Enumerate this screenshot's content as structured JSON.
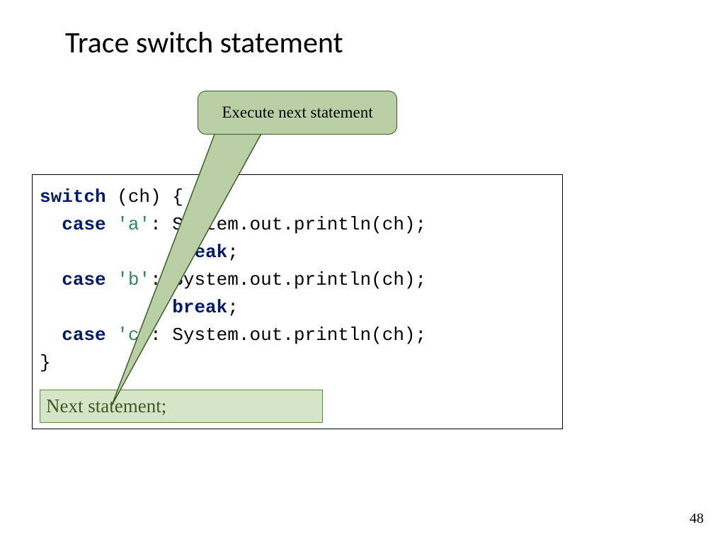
{
  "title": "Trace switch statement",
  "callout_label": "Execute next statement",
  "code": {
    "line1_kw": "switch",
    "line1_rest": " (ch) {",
    "case_kw": "case",
    "break_kw": "break",
    "lit_a": "'a'",
    "lit_b": "'b'",
    "lit_c": "'c'",
    "colon_stmt": ": System.out.println(ch);",
    "semi": ";",
    "close_brace": "}"
  },
  "highlight_text": "Next statement;",
  "page_number": "48"
}
